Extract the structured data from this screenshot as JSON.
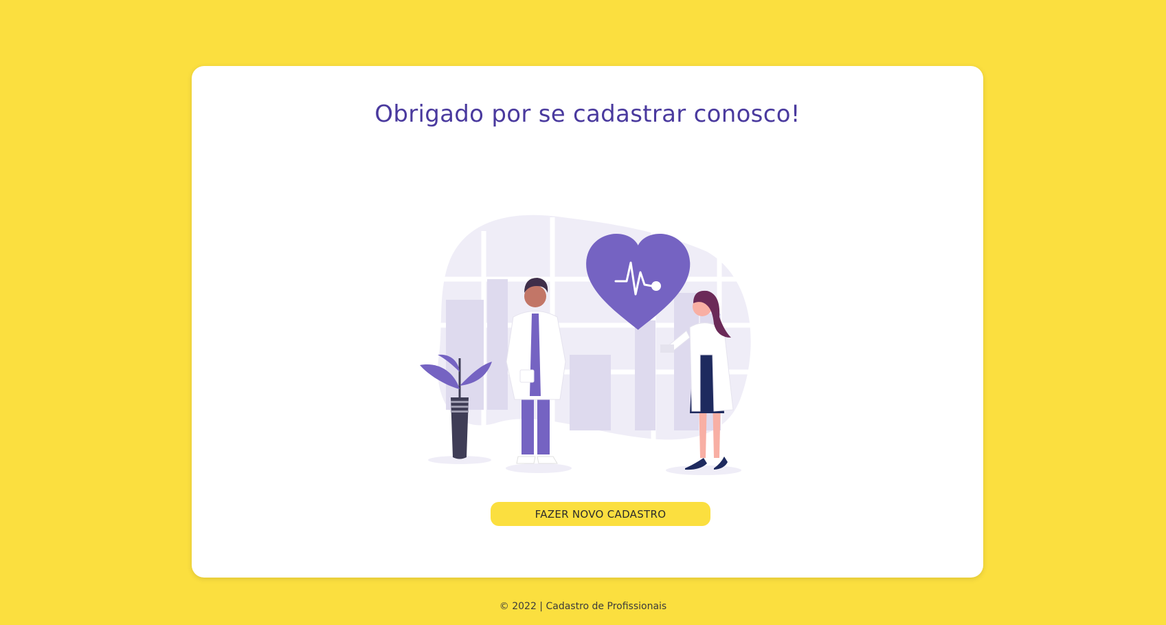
{
  "card": {
    "title": "Obrigado por se cadastrar conosco!",
    "illustration": {
      "icon": "doctors-heart-illustration",
      "accent_color": "#7563C2"
    },
    "button_label": "FAZER NOVO CADASTRO"
  },
  "footer": {
    "text": "© 2022 | Cadastro de Profissionais"
  },
  "colors": {
    "background": "#FBDF3F",
    "card": "#FFFFFF",
    "title": "#4A3A9E",
    "button": "#FBDF3F"
  }
}
